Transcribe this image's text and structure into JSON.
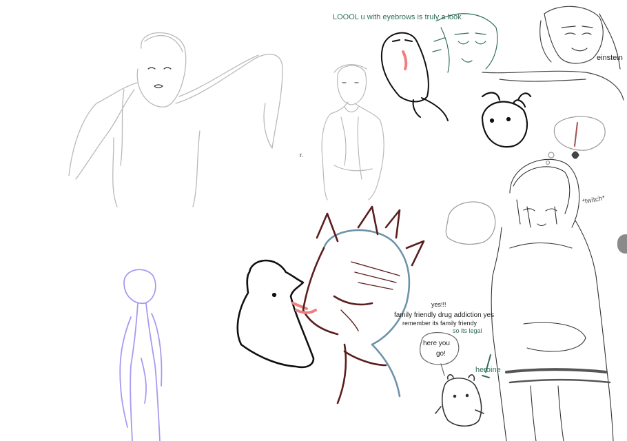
{
  "canvas": {
    "background": "#ffffff",
    "stroke_colors": {
      "gray_sketch": "#b9b9b9",
      "black_ink": "#111111",
      "teal_ink": "#2f6f5a",
      "purple_ink": "#a89af0",
      "maroon_ink": "#5b1e1e",
      "slate_ink": "#6e93a8",
      "pink_tongue": "#f08080",
      "gray_doodle": "#444444"
    }
  },
  "texts": {
    "loool": "LOOOL u with eyebrows is truly a look",
    "einstein": "einstein",
    "twitch": "*twitch*",
    "small_r": "r.",
    "yes": "yes!!!",
    "family_addiction": "family friendly drug addiction yes",
    "remember_family": "remember its family friendy",
    "so_legal": "so its legal",
    "here_you": "here you",
    "go": "go!",
    "heroine": "heroine"
  },
  "scroll_handle": {
    "icon": "scroll-handle-icon",
    "color": "#8a8a8a"
  }
}
